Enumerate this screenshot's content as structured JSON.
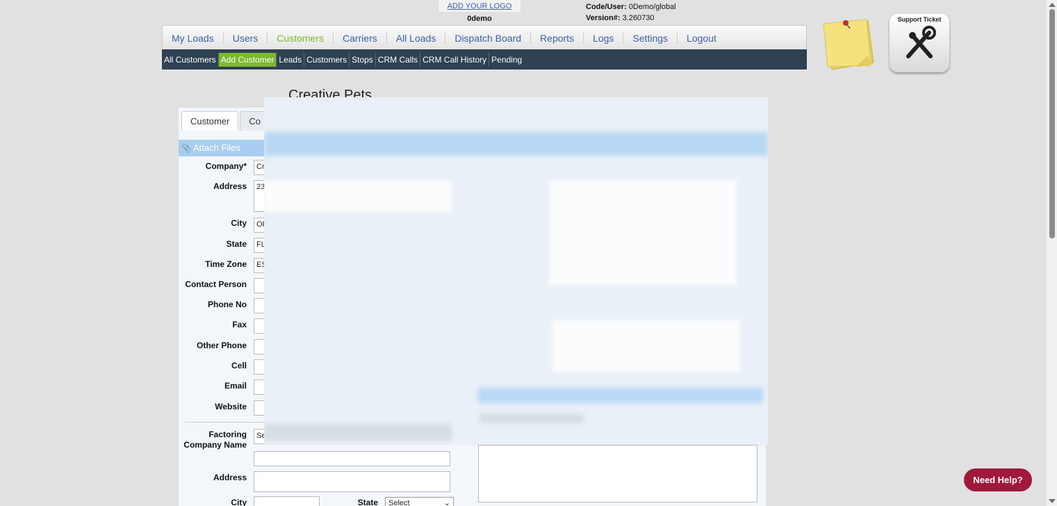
{
  "header": {
    "logo_link": "ADD YOUR LOGO",
    "logo_sub": "0demo",
    "code_user_label": "Code/User:",
    "code_user_value": "0Demo/global",
    "version_label": "Version#:",
    "version_value": "3.260730"
  },
  "topnav": {
    "items": [
      {
        "label": "My Loads"
      },
      {
        "label": "Users"
      },
      {
        "label": "Customers",
        "active": true
      },
      {
        "label": "Carriers"
      },
      {
        "label": "All Loads"
      },
      {
        "label": "Dispatch Board"
      },
      {
        "label": "Reports"
      },
      {
        "label": "Logs"
      },
      {
        "label": "Settings"
      },
      {
        "label": "Logout"
      }
    ]
  },
  "subnav": {
    "items": [
      {
        "label": "All Customers"
      },
      {
        "label": "Add Customer",
        "active": true
      },
      {
        "label": "Leads"
      },
      {
        "label": "Customers"
      },
      {
        "label": "Stops"
      },
      {
        "label": "CRM Calls"
      },
      {
        "label": "CRM Call History"
      },
      {
        "label": "Pending"
      }
    ]
  },
  "widgets": {
    "support_ticket_label": "Support Ticket",
    "need_help": "Need Help?"
  },
  "page": {
    "company_title": "Creative Pets"
  },
  "form": {
    "tabs": [
      {
        "label": "Customer",
        "active": true
      },
      {
        "label": "Co"
      }
    ],
    "attach_files": "Attach Files",
    "labels": {
      "company": "Company*",
      "address": "Address",
      "city": "City",
      "state": "State",
      "time_zone": "Time Zone",
      "contact_person": "Contact Person",
      "phone_no": "Phone No",
      "fax": "Fax",
      "other_phone": "Other Phone",
      "cell": "Cell",
      "email": "Email",
      "website": "Website",
      "factoring_company_name": "Factoring Company Name",
      "factoring_address": "Address",
      "factoring_city": "City",
      "factoring_state": "State"
    },
    "values": {
      "company": "Cr",
      "address": "23",
      "city": "OR",
      "state": "FL",
      "time_zone": "ES",
      "factoring_company_name": "Se"
    },
    "factoring_state_select": "Select"
  },
  "colors": {
    "accent_green": "#7cb82f",
    "nav_blue_text": "#3a5fa8",
    "subnav_bg": "#2f4152",
    "need_help_bg": "#a0183a"
  }
}
